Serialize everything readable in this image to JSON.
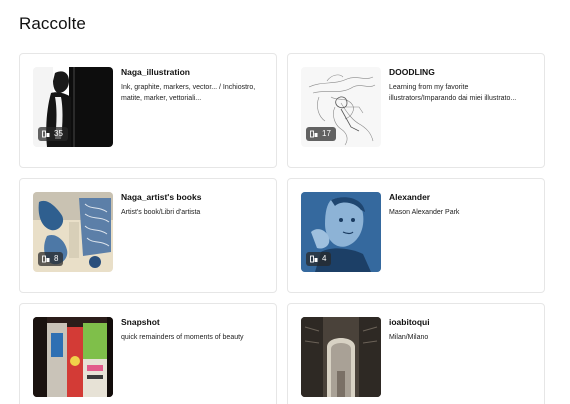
{
  "page": {
    "title": "Raccolte"
  },
  "collections": [
    {
      "title": "Naga_illustration",
      "description": "Ink, graphite, markers, vector... / Inchiostro, matite, marker, vettoriali...",
      "count": "35",
      "thumb_icon": "bw-figure-photo"
    },
    {
      "title": "DOODLING",
      "description": "Learning from my favorite illustrators/Imparando dai miei illustrato...",
      "count": "17",
      "thumb_icon": "pencil-sketch-drawing"
    },
    {
      "title": "Naga_artist's books",
      "description": "Artist's book/Libri d'artista",
      "count": "8",
      "thumb_icon": "blue-collage-book"
    },
    {
      "title": "Alexander",
      "description": "Mason Alexander Park",
      "count": "4",
      "thumb_icon": "blue-portrait"
    },
    {
      "title": "Snapshot",
      "description": "quick remainders of moments of beauty",
      "count": "",
      "thumb_icon": "street-posters-photo"
    },
    {
      "title": "ioabitoqui",
      "description": "Milan/Milano",
      "count": "",
      "thumb_icon": "galleria-arcade-photo"
    }
  ],
  "colors": {
    "badge_bg": "#3a3a3a",
    "border": "#e6e6e6"
  },
  "icons": {
    "badge_icon": "collection-items-icon"
  }
}
